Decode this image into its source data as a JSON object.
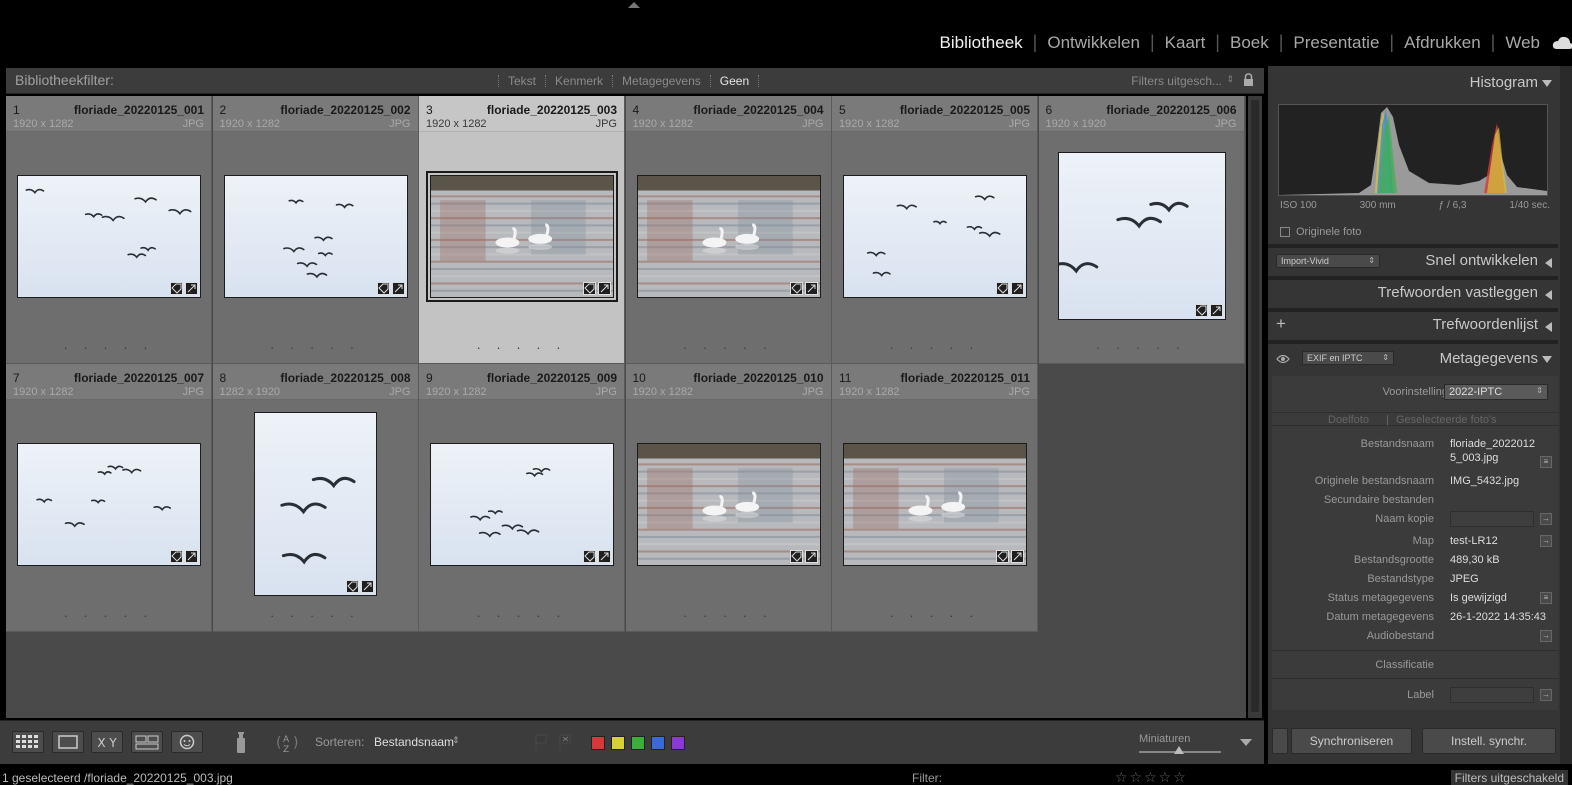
{
  "modules": {
    "items": [
      "Bibliotheek",
      "Ontwikkelen",
      "Kaart",
      "Boek",
      "Presentatie",
      "Afdrukken",
      "Web"
    ],
    "active": "Bibliotheek"
  },
  "filterbar": {
    "label": "Bibliotheekfilter:",
    "tabs": [
      "Tekst",
      "Kenmerk",
      "Metagegevens",
      "Geen"
    ],
    "active_tab": "Geen",
    "filters_off": "Filters uitgesch..."
  },
  "grid": {
    "photos": [
      {
        "num": "1",
        "name": "floriade_20220125_001",
        "dims": "1920 x 1282",
        "type": "JPG",
        "scene": "birds",
        "orientation": "landscape"
      },
      {
        "num": "2",
        "name": "floriade_20220125_002",
        "dims": "1920 x 1282",
        "type": "JPG",
        "scene": "birds",
        "orientation": "landscape"
      },
      {
        "num": "3",
        "name": "floriade_20220125_003",
        "dims": "1920 x 1282",
        "type": "JPG",
        "scene": "swans",
        "orientation": "landscape",
        "selected": true
      },
      {
        "num": "4",
        "name": "floriade_20220125_004",
        "dims": "1920 x 1282",
        "type": "JPG",
        "scene": "swans",
        "orientation": "landscape"
      },
      {
        "num": "5",
        "name": "floriade_20220125_005",
        "dims": "1920 x 1282",
        "type": "JPG",
        "scene": "birds",
        "orientation": "landscape"
      },
      {
        "num": "6",
        "name": "floriade_20220125_006",
        "dims": "1920 x 1920",
        "type": "JPG",
        "scene": "birds",
        "orientation": "square"
      },
      {
        "num": "7",
        "name": "floriade_20220125_007",
        "dims": "1920 x 1282",
        "type": "JPG",
        "scene": "birds",
        "orientation": "landscape"
      },
      {
        "num": "8",
        "name": "floriade_20220125_008",
        "dims": "1282 x 1920",
        "type": "JPG",
        "scene": "birds",
        "orientation": "portrait"
      },
      {
        "num": "9",
        "name": "floriade_20220125_009",
        "dims": "1920 x 1282",
        "type": "JPG",
        "scene": "birds",
        "orientation": "landscape"
      },
      {
        "num": "10",
        "name": "floriade_20220125_010",
        "dims": "1920 x 1282",
        "type": "JPG",
        "scene": "swans",
        "orientation": "landscape"
      },
      {
        "num": "11",
        "name": "floriade_20220125_011",
        "dims": "1920 x 1282",
        "type": "JPG",
        "scene": "swans",
        "orientation": "landscape"
      }
    ],
    "rating_dots": "· · · · ·"
  },
  "toolbar": {
    "sort_label": "Sorteren:",
    "sort_value": "Bestandsnaam",
    "color_labels": [
      "#d43a3a",
      "#d6d03a",
      "#3ab03a",
      "#3a6ad4",
      "#8a3ad4"
    ],
    "thumbnails_label": "Miniaturen"
  },
  "statusbar": {
    "selection": "1 geselecteerd /floriade_20220125_003.jpg",
    "filter_label": "Filter:",
    "filters_off": "Filters uitgeschakeld"
  },
  "rightpanel": {
    "histogram": {
      "title": "Histogram",
      "iso": "ISO 100",
      "focal": "300 mm",
      "aperture": "ƒ / 6,3",
      "shutter": "1/40 sec.",
      "original_photo": "Originele foto"
    },
    "quick_develop": {
      "title": "Snel ontwikkelen",
      "preset": "Import-Vivid"
    },
    "keywording": {
      "title": "Trefwoorden vastleggen"
    },
    "keyword_list": {
      "title": "Trefwoordenlijst",
      "add": "+"
    },
    "metadata": {
      "title": "Metagegevens",
      "view": "EXIF en IPTC",
      "preset_label": "Voorinstelling",
      "preset_value": "2022-IPTC",
      "target_photo": "Doelfoto",
      "selected_photos": "Geselecteerde foto's",
      "fields": {
        "filename_label": "Bestandsnaam",
        "filename_line1": "floriade_2022012",
        "filename_line2": "5_003.jpg",
        "original_filename_label": "Originele bestandsnaam",
        "original_filename": "IMG_5432.jpg",
        "sidecar_label": "Secundaire bestanden",
        "copy_name_label": "Naam kopie",
        "folder_label": "Map",
        "folder": "test-LR12",
        "filesize_label": "Bestandsgrootte",
        "filesize": "489,30 kB",
        "filetype_label": "Bestandstype",
        "filetype": "JPEG",
        "meta_status_label": "Status metagegevens",
        "meta_status": "Is gewijzigd",
        "meta_date_label": "Datum metagegevens",
        "meta_date": "26-1-2022 14:35:43",
        "audio_label": "Audiobestand",
        "rating_label": "Classificatie",
        "label_label": "Label"
      }
    },
    "sync_button": "Synchroniseren",
    "autosync_button": "Instell. synchr."
  }
}
